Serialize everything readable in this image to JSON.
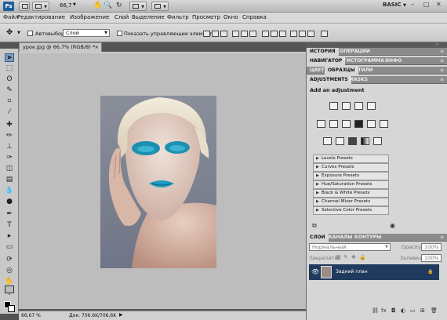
{
  "appbar": {
    "logo": "Ps",
    "zoom": "66,7",
    "workspace": "BASIC",
    "window_controls": [
      "–",
      "□",
      "✕"
    ]
  },
  "menubar": {
    "items": [
      "Файл",
      "Редактирование",
      "Изображение",
      "Слой",
      "Выделение",
      "Фильтр",
      "Просмотр",
      "Окно",
      "Справка"
    ]
  },
  "options": {
    "autoselect_label": "Автовыбор:",
    "autoselect_value": "Слой",
    "show_controls_label": "Показать управляющие элементы"
  },
  "document": {
    "tab_title": "урок.jpg @ 66,7% (RGB/8) *",
    "close": "×"
  },
  "status": {
    "zoom": "66,67 %",
    "doc_info": "Док: 706,6K/706,6K"
  },
  "panels": {
    "top_tabs": [
      "ИСТОРИЯ",
      "ОПЕРАЦИИ"
    ],
    "nav_tabs": [
      "НАВИГАТОР",
      "ГИСТОГРАММА",
      "ИНФО"
    ],
    "color_tabs": [
      "ЦВЕТ",
      "ОБРАЗЦЫ",
      "СТИЛИ"
    ],
    "adj_tabs": [
      "ADJUSTMENTS",
      "MASKS"
    ],
    "adj_heading": "Add an adjustment",
    "presets": [
      "Levels Presets",
      "Curves Presets",
      "Exposure Presets",
      "Hue/Saturation Presets",
      "Black & White Presets",
      "Channel Mixer Presets",
      "Selective Color Presets"
    ],
    "layers_tabs": [
      "СЛОИ",
      "КАНАЛЫ",
      "КОНТУРЫ"
    ],
    "blend_mode": "Нормальный",
    "opacity_label": "Opacity:",
    "opacity_value": "100%",
    "lock_label": "Закрепить:",
    "fill_label": "Заливка:",
    "fill_value": "100%",
    "layer_name": "Задний план"
  },
  "colors": {
    "accent_blue": "#1f3a5d",
    "canvas_bg": "#bdbdbd",
    "makeup_teal": "#1d8fb1"
  }
}
